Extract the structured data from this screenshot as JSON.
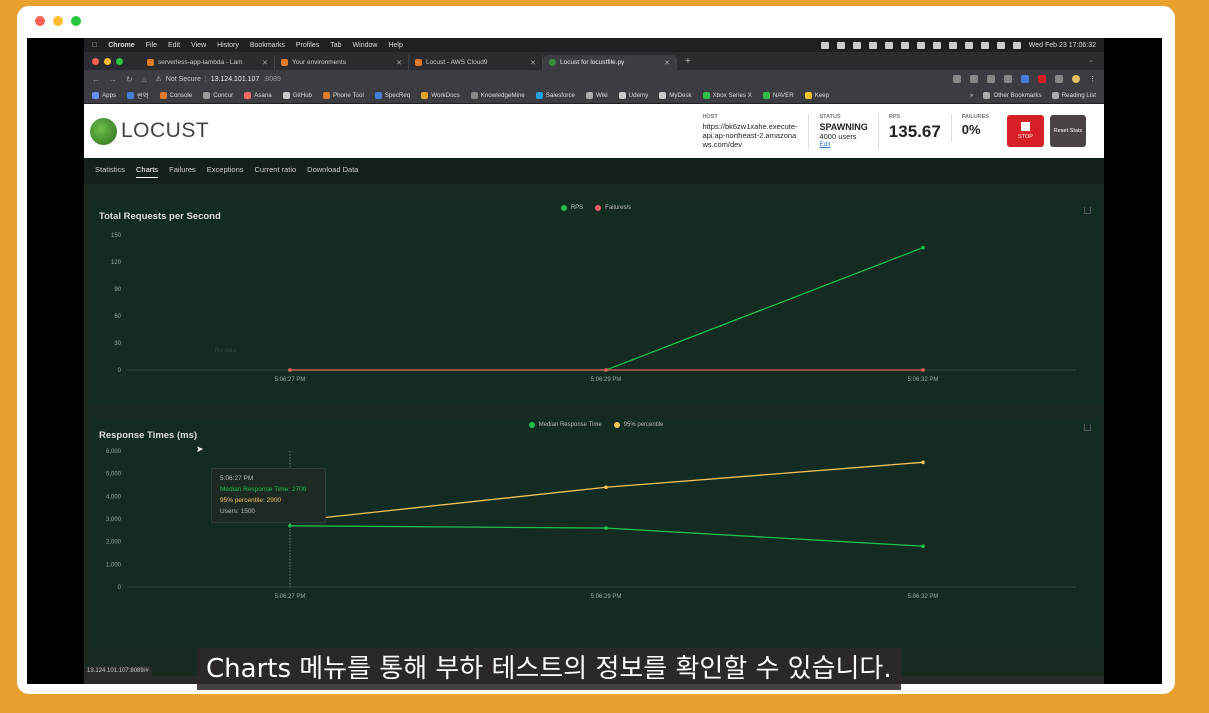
{
  "colors": {
    "page_bg": "#e8a12f",
    "dot_red": "#ff5f57",
    "dot_yellow": "#febc2e",
    "dot_green": "#28c840",
    "rps_green": "#1fbd4e",
    "failure_red": "#e85e5e",
    "p95_yellow": "#f5c45a",
    "stop_red": "#d71f26"
  },
  "menubar": {
    "apple_icon": "apple-icon",
    "items": [
      "Chrome",
      "File",
      "Edit",
      "View",
      "History",
      "Bookmarks",
      "Profiles",
      "Tab",
      "Window",
      "Help"
    ],
    "datetime": "Wed Feb 23  17:06:32"
  },
  "tabs": [
    {
      "title": "serverless-app-lambda - Lam",
      "icon": "lambda-icon",
      "color": "#e07b2a"
    },
    {
      "title": "Your environments",
      "icon": "cube-icon",
      "color": "#e07b2a"
    },
    {
      "title": "Locust - AWS Cloud9",
      "icon": "cloud9-icon",
      "color": "#e07b2a"
    },
    {
      "title": "Locust for locustfile.py",
      "icon": "locust-icon",
      "color": "#3a8d3a",
      "active": true
    }
  ],
  "address": {
    "security": "Not Secure",
    "host": "13.124.101.107",
    "port": ":8089"
  },
  "bookmarks": [
    {
      "label": "Apps",
      "color": "#6a8cff"
    },
    {
      "label": "번역",
      "color": "#4a7cdc"
    },
    {
      "label": "Console",
      "color": "#e07b2a"
    },
    {
      "label": "Concur",
      "color": "#999999"
    },
    {
      "label": "Asana",
      "color": "#f06a6a"
    },
    {
      "label": "GitHub",
      "color": "#cccccc"
    },
    {
      "label": "Phone Tool",
      "color": "#e07b2a"
    },
    {
      "label": "SpecReq",
      "color": "#4a7cdc"
    },
    {
      "label": "WorkDocs",
      "color": "#e0a22a"
    },
    {
      "label": "KnowledgeMine",
      "color": "#888888"
    },
    {
      "label": "Salesforce",
      "color": "#1a9fe0"
    },
    {
      "label": "Wiki",
      "color": "#aaaaaa"
    },
    {
      "label": "Udemy",
      "color": "#cccccc"
    },
    {
      "label": "MyDesk",
      "color": "#cccccc"
    },
    {
      "label": "Xbox Series X",
      "color": "#2fbf4a"
    },
    {
      "label": "NAVER",
      "color": "#2fbf4a"
    },
    {
      "label": "Keep",
      "color": "#f5c22a"
    }
  ],
  "bookmarks_more": "»",
  "bookmarks_right": [
    "Other Bookmarks",
    "Reading List"
  ],
  "locust": {
    "logo_text": "LOCUST",
    "host_label": "HOST",
    "host_value": "https://bk6zw1xahe.execute-api.ap-northeast-2.amazonaws.com/dev",
    "status_label": "STATUS",
    "status_value": "SPAWNING",
    "users": "4000 users",
    "edit": "Edit",
    "rps_label": "RPS",
    "rps_value": "135.67",
    "failures_label": "FAILURES",
    "failures_value": "0%",
    "stop_label": "STOP",
    "reset_label": "Reset Stats",
    "tabs": [
      "Statistics",
      "Charts",
      "Failures",
      "Exceptions",
      "Current ratio",
      "Download Data"
    ],
    "active_tab": "Charts"
  },
  "chart_data": [
    {
      "type": "line",
      "title": "Total Requests per Second",
      "categories": [
        "5:06:27 PM",
        "5:06:29 PM",
        "5:06:32 PM"
      ],
      "series": [
        {
          "name": "RPS",
          "values": [
            0,
            0,
            136
          ],
          "color": "#1fbd4e"
        },
        {
          "name": "Failures/s",
          "values": [
            0,
            0,
            0
          ],
          "color": "#e85e5e"
        }
      ],
      "ylim": [
        0,
        150
      ],
      "yticks": [
        "150",
        "120",
        "90",
        "60",
        "30",
        "0"
      ],
      "watermark": "No data"
    },
    {
      "type": "line",
      "title": "Response Times (ms)",
      "categories": [
        "5:06:27 PM",
        "5:06:29 PM",
        "5:06:32 PM"
      ],
      "series": [
        {
          "name": "Median Response Time",
          "values": [
            2700,
            2600,
            1800
          ],
          "color": "#1fbd4e"
        },
        {
          "name": "95% percentile",
          "values": [
            2900,
            4400,
            5500
          ],
          "color": "#f5c45a"
        }
      ],
      "ylim": [
        0,
        6000
      ],
      "yticks": [
        "6,000",
        "5,000",
        "4,000",
        "3,000",
        "2,000",
        "1,000",
        "0"
      ],
      "tooltip": {
        "time": "5:06:27 PM",
        "median": "Median Response Time: 2700",
        "p95": "95% percentile: 2900",
        "users": "Users: 1500"
      }
    }
  ],
  "status_url": "13.124.101.107:8089/#",
  "subtitle": "Charts 메뉴를 통해 부하 테스트의 정보를 확인할 수 있습니다."
}
